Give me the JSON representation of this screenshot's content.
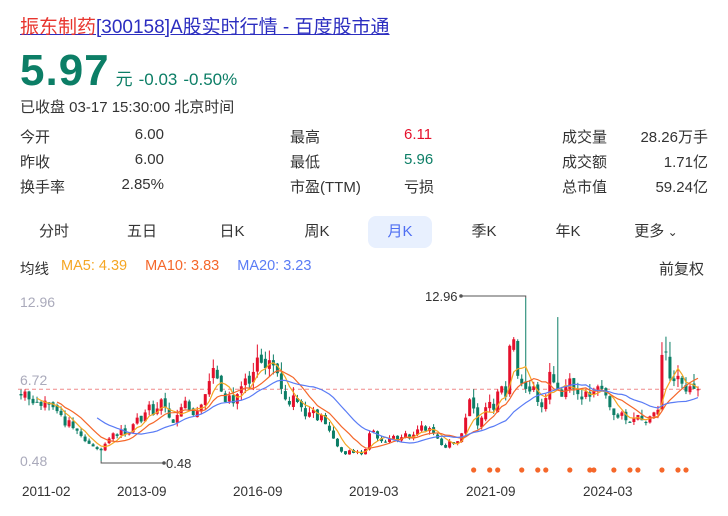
{
  "title": {
    "name": "振东制药",
    "rest": "[300158]A股实时行情 - 百度股市通"
  },
  "price": {
    "value": "5.97",
    "unit": "元",
    "change": "-0.03",
    "change_pct": "-0.50%"
  },
  "status": "已收盘 03-17 15:30:00 北京时间",
  "stats": [
    {
      "label": "今开",
      "value": "6.00"
    },
    {
      "label": "最高",
      "value": "6.11"
    },
    {
      "label": "成交量",
      "value": "28.26万手"
    },
    {
      "label": "昨收",
      "value": "6.00"
    },
    {
      "label": "最低",
      "value": "5.96"
    },
    {
      "label": "成交额",
      "value": "1.71亿"
    },
    {
      "label": "换手率",
      "value": "2.85%"
    },
    {
      "label": "市盈(TTM)",
      "value": "亏损"
    },
    {
      "label": "总市值",
      "value": "59.24亿"
    }
  ],
  "tabs": [
    "分时",
    "五日",
    "日K",
    "周K",
    "月K",
    "季K",
    "年K",
    "更多"
  ],
  "active_tab": "月K",
  "ma": {
    "label": "均线",
    "ma5": "MA5: 4.39",
    "ma10": "MA10: 3.83",
    "ma20": "MA20: 3.23"
  },
  "adjust": "前复权",
  "colors": {
    "up": "#e5102b",
    "down": "#0c7e66",
    "ma5": "#f5a623",
    "ma10": "#f5672a",
    "ma20": "#5a7cf5",
    "event": "#f5672a"
  },
  "chart_data": {
    "type": "candlestick",
    "period": "monthly",
    "y_ticks": [
      "12.96",
      "6.72",
      "0.48"
    ],
    "ylim": [
      0.48,
      12.96
    ],
    "x_ticks": [
      "2011-02",
      "2013-09",
      "2016-09",
      "2019-03",
      "2021-09",
      "2024-03"
    ],
    "max_label": "12.96",
    "min_label": "0.48",
    "last_close": 5.97,
    "close": [
      5.5,
      5.8,
      5.2,
      4.9,
      5.0,
      4.7,
      5.1,
      4.8,
      4.6,
      4.3,
      4.0,
      3.2,
      3.6,
      3.0,
      2.8,
      2.4,
      2.0,
      1.8,
      1.6,
      1.4,
      1.3,
      1.8,
      2.2,
      2.6,
      2.4,
      2.9,
      2.5,
      2.7,
      3.3,
      3.8,
      3.5,
      4.2,
      4.8,
      4.0,
      4.5,
      5.2,
      4.6,
      3.8,
      3.4,
      4.0,
      4.6,
      5.1,
      4.4,
      4.0,
      4.3,
      4.8,
      5.6,
      6.6,
      7.6,
      6.8,
      5.8,
      5.0,
      5.5,
      4.9,
      5.6,
      6.2,
      6.8,
      6.4,
      7.3,
      8.4,
      8.0,
      7.6,
      8.2,
      7.8,
      7.2,
      6.0,
      5.2,
      4.8,
      5.5,
      5.0,
      4.6,
      3.9,
      4.2,
      4.4,
      3.6,
      4.0,
      3.3,
      2.8,
      2.2,
      1.6,
      1.2,
      1.0,
      1.3,
      1.1,
      1.2,
      1.0,
      1.4,
      2.6,
      2.8,
      2.2,
      2.0,
      1.9,
      2.2,
      2.4,
      2.0,
      2.3,
      2.6,
      2.2,
      2.5,
      2.9,
      3.2,
      2.8,
      3.0,
      2.6,
      2.2,
      1.7,
      1.5,
      2.0,
      1.8,
      2.0,
      2.6,
      3.8,
      5.2,
      4.5,
      3.2,
      3.8,
      4.6,
      5.0,
      4.4,
      5.8,
      6.2,
      5.4,
      9.3,
      9.8,
      7.0,
      6.4,
      6.0,
      5.8,
      6.2,
      5.0,
      4.6,
      5.3,
      7.3,
      6.5,
      6.0,
      5.4,
      6.2,
      6.8,
      6.0,
      5.6,
      5.2,
      5.8,
      5.4,
      5.8,
      6.2,
      6.0,
      5.5,
      4.6,
      4.0,
      3.8,
      4.2,
      3.6,
      3.4,
      3.8,
      4.0,
      3.6,
      3.4,
      3.9,
      4.2,
      4.4,
      8.6,
      8.8,
      6.8,
      6.6,
      7.0,
      6.4,
      5.8,
      6.2,
      6.0,
      5.97
    ],
    "high_overrides": {
      "20": 1.5,
      "126": 12.96,
      "134": 11.5,
      "161": 10.0,
      "162": 9.6
    },
    "low_overrides": {
      "20": 0.48
    },
    "event_indices": [
      113,
      117,
      119,
      125,
      129,
      131,
      137,
      142,
      143,
      148,
      152,
      154,
      160,
      164,
      166
    ]
  }
}
